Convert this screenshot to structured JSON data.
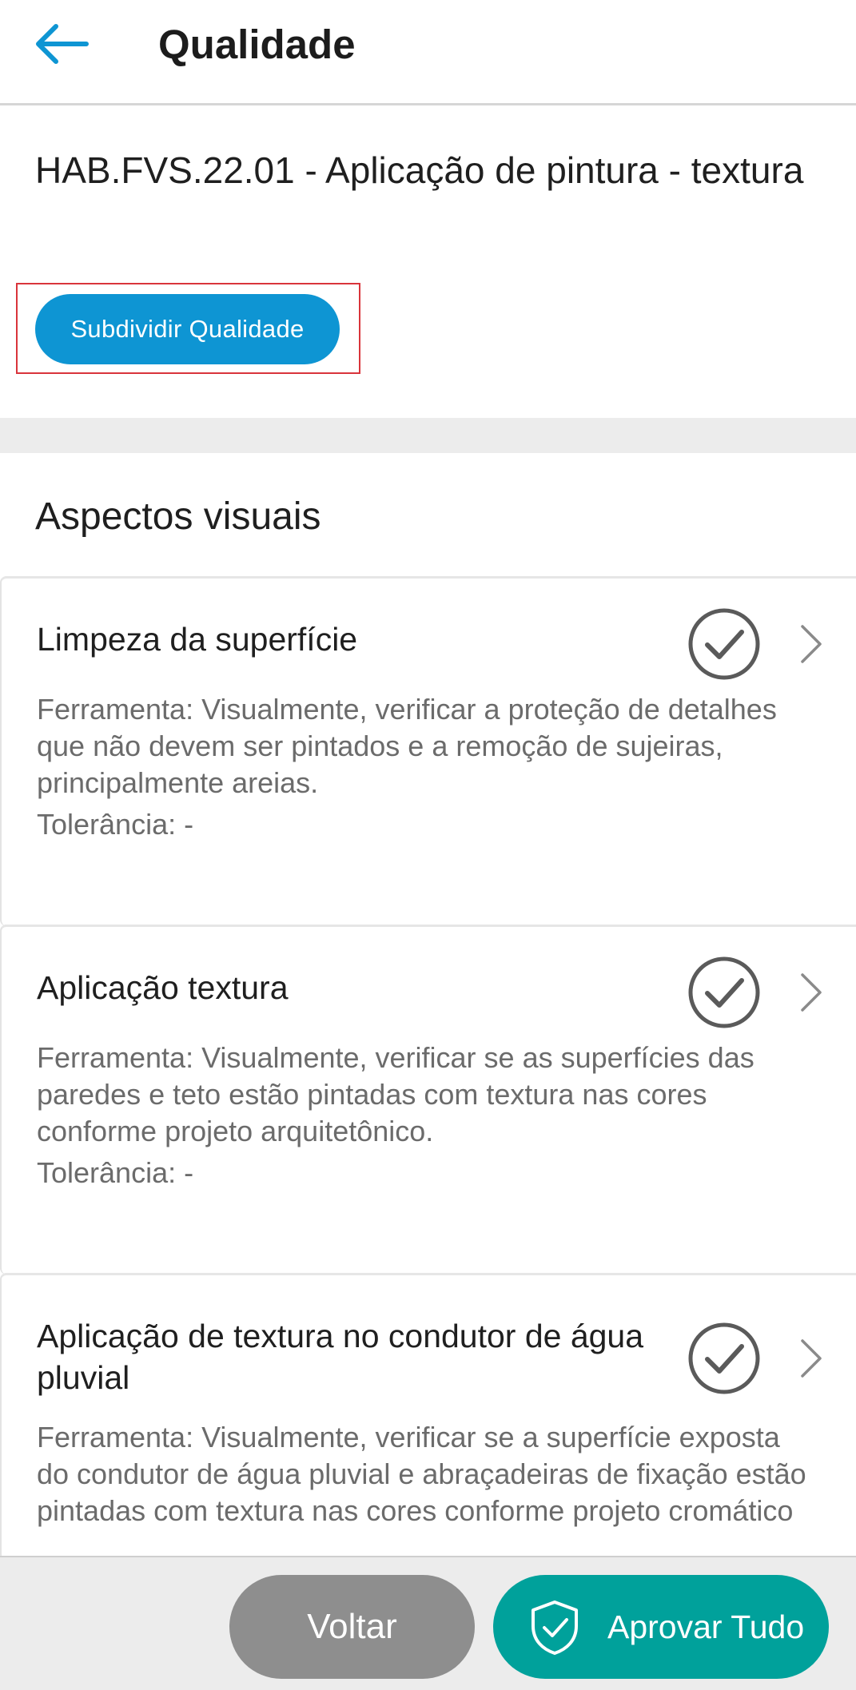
{
  "header": {
    "title": "Qualidade",
    "back_icon": "arrow-left-icon"
  },
  "info": {
    "fvs_title": "HAB.FVS.22.01 - Aplicação de pintura - textura",
    "subdivide_label": "Subdividir Qualidade"
  },
  "section": {
    "title": "Aspectos visuais",
    "items": [
      {
        "title": "Limpeza da superfície",
        "desc_lines": [
          "Ferramenta: Visualmente, verificar a proteção de detalhes",
          "que não devem ser pintados e a remoção de sujeiras,",
          "principalmente areias."
        ],
        "tolerance": "Tolerância: -",
        "status_icon": "check-circle-icon"
      },
      {
        "title": "Aplicação textura",
        "desc_lines": [
          "Ferramenta: Visualmente, verificar se as superfícies das",
          "paredes e teto estão pintadas com textura nas cores",
          "conforme projeto arquitetônico."
        ],
        "tolerance": "Tolerância: -",
        "status_icon": "check-circle-icon"
      },
      {
        "title": "Aplicação de textura no condutor de água pluvial",
        "desc_lines": [
          "Ferramenta: Visualmente, verificar se a superfície exposta",
          "do condutor de água pluvial e abraçadeiras de fixação estão",
          "pintadas com textura nas cores conforme projeto cromático"
        ],
        "status_icon": "check-circle-icon"
      }
    ]
  },
  "footer": {
    "back_label": "Voltar",
    "approve_label": "Aprovar Tudo"
  },
  "colors": {
    "accent_blue": "#0e95d3",
    "approve_teal": "#00a19b",
    "back_gray": "#8e8e8e",
    "highlight_red": "#d9343b"
  }
}
